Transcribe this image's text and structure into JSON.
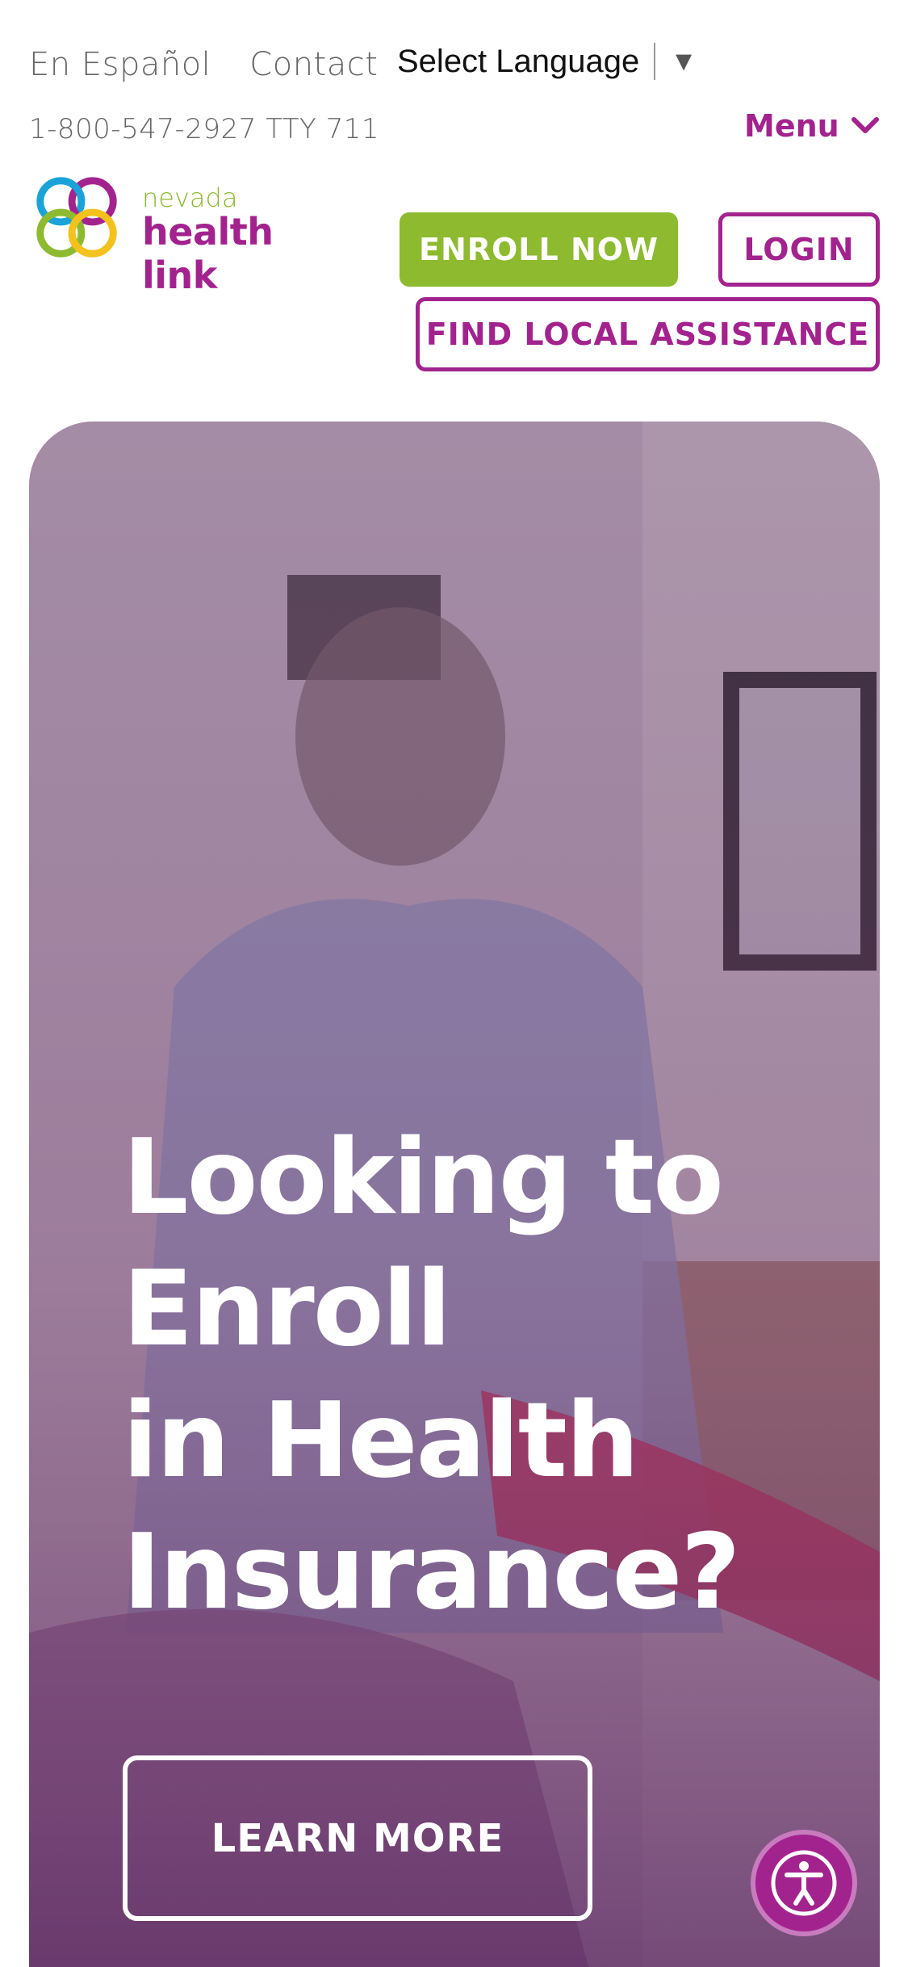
{
  "header": {
    "links": [
      "En Español",
      "Contact"
    ],
    "language_select": {
      "label": "Select Language",
      "arrow": "▼"
    },
    "phone": "1-800-547-2927 TTY 711",
    "menu_label": "Menu"
  },
  "logo": {
    "line1": "nevada",
    "line2": "health link"
  },
  "actions": {
    "enroll": "ENROLL NOW",
    "login": "LOGIN",
    "assistance": "FIND LOCAL ASSISTANCE"
  },
  "hero": {
    "title_lines": [
      "Looking to",
      "Enroll",
      "in Health",
      "Insurance?"
    ],
    "cta": "LEARN MORE"
  },
  "colors": {
    "brand_purple": "#a3238e",
    "brand_green": "#8dba2f"
  },
  "icons": {
    "menu": "chevron-down-icon",
    "accessibility": "accessibility-icon"
  }
}
